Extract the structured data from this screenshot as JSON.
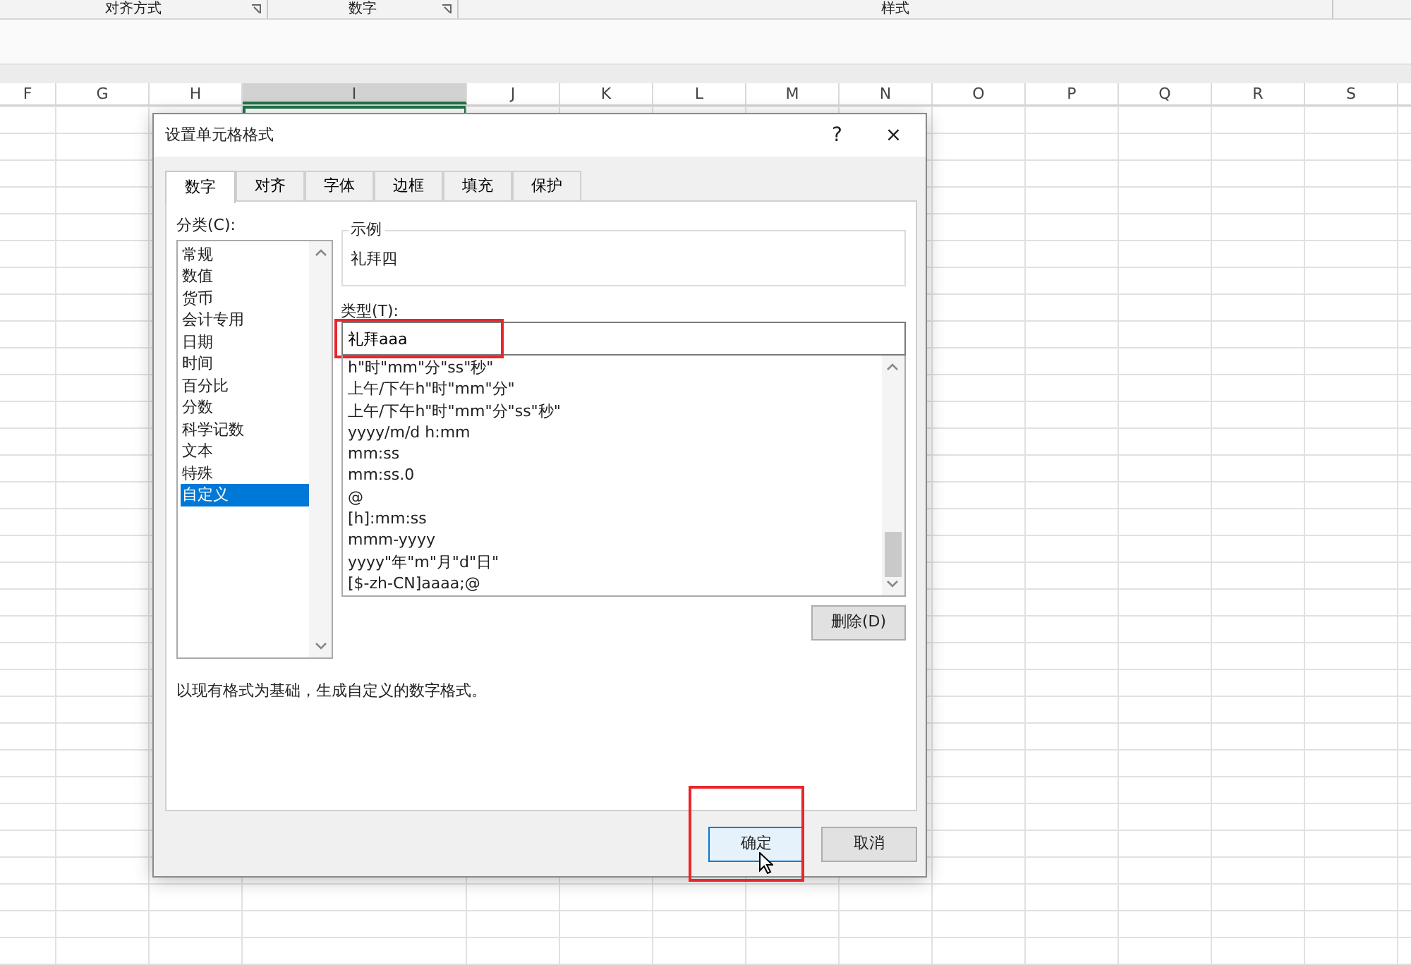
{
  "ribbon": {
    "groups": [
      {
        "label": "对齐方式",
        "launcher": true
      },
      {
        "label": "数字",
        "launcher": true
      },
      {
        "label": "样式",
        "launcher": false
      }
    ]
  },
  "sheet": {
    "columns": [
      {
        "label": "F",
        "selected": false
      },
      {
        "label": "G",
        "selected": false
      },
      {
        "label": "H",
        "selected": false
      },
      {
        "label": "I",
        "selected": true
      },
      {
        "label": "J",
        "selected": false
      },
      {
        "label": "K",
        "selected": false
      },
      {
        "label": "L",
        "selected": false
      },
      {
        "label": "M",
        "selected": false
      },
      {
        "label": "N",
        "selected": false
      },
      {
        "label": "O",
        "selected": false
      },
      {
        "label": "P",
        "selected": false
      },
      {
        "label": "Q",
        "selected": false
      },
      {
        "label": "R",
        "selected": false
      },
      {
        "label": "S",
        "selected": false
      }
    ]
  },
  "dialog": {
    "title": "设置单元格格式",
    "help": "?",
    "close": "×",
    "tabs": [
      {
        "label": "数字",
        "selected": true
      },
      {
        "label": "对齐",
        "selected": false
      },
      {
        "label": "字体",
        "selected": false
      },
      {
        "label": "边框",
        "selected": false
      },
      {
        "label": "填充",
        "selected": false
      },
      {
        "label": "保护",
        "selected": false
      }
    ],
    "category_label": "分类(C):",
    "categories": [
      {
        "label": "常规",
        "selected": false
      },
      {
        "label": "数值",
        "selected": false
      },
      {
        "label": "货币",
        "selected": false
      },
      {
        "label": "会计专用",
        "selected": false
      },
      {
        "label": "日期",
        "selected": false
      },
      {
        "label": "时间",
        "selected": false
      },
      {
        "label": "百分比",
        "selected": false
      },
      {
        "label": "分数",
        "selected": false
      },
      {
        "label": "科学记数",
        "selected": false
      },
      {
        "label": "文本",
        "selected": false
      },
      {
        "label": "特殊",
        "selected": false
      },
      {
        "label": "自定义",
        "selected": true
      }
    ],
    "sample_label": "示例",
    "sample_value": "礼拜四",
    "type_label": "类型(T):",
    "type_value": "礼拜aaa",
    "type_highlighted": true,
    "formats": [
      "h\"时\"mm\"分\"ss\"秒\"",
      "上午/下午h\"时\"mm\"分\"",
      "上午/下午h\"时\"mm\"分\"ss\"秒\"",
      "yyyy/m/d h:mm",
      "mm:ss",
      "mm:ss.0",
      "@",
      "[h]:mm:ss",
      "mmm-yyyy",
      "yyyy\"年\"m\"月\"d\"日\"",
      "[$-zh-CN]aaaa;@"
    ],
    "delete_button": "删除(D)",
    "description": "以现有格式为基础，生成自定义的数字格式。",
    "ok_button": {
      "label": "确定",
      "highlighted": true,
      "hovered": true
    },
    "cancel_button": {
      "label": "取消",
      "highlighted": false,
      "hovered": false
    }
  }
}
